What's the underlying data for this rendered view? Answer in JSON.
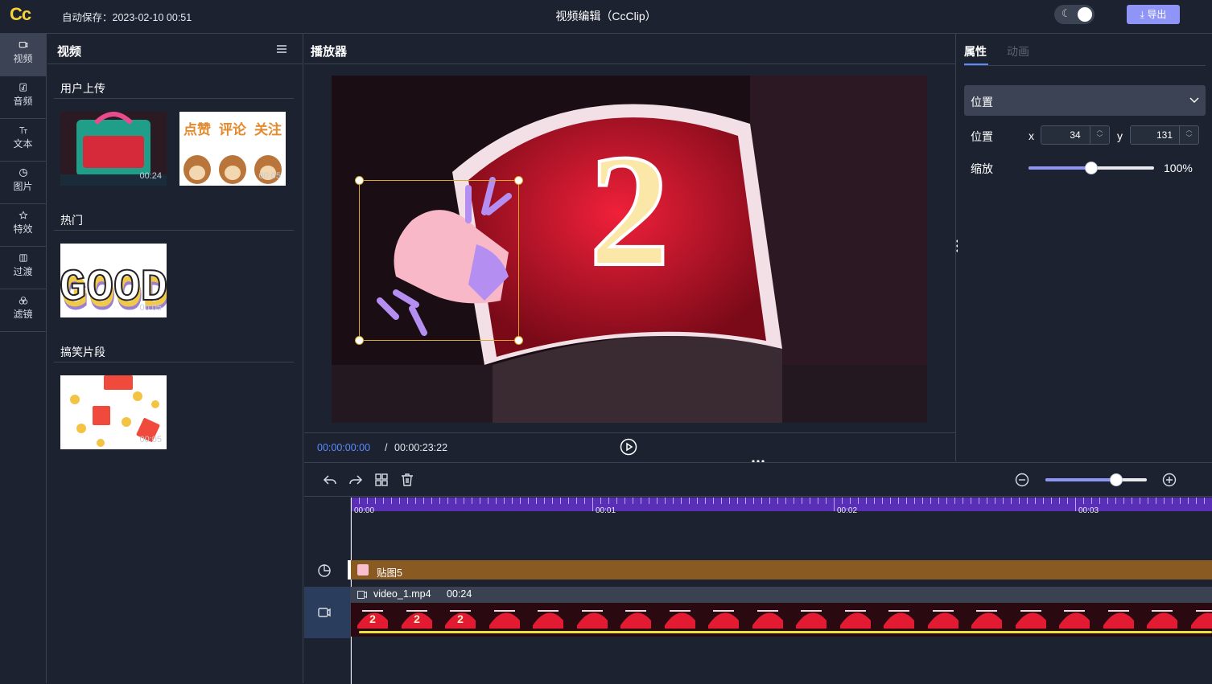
{
  "app": {
    "logo": "Cc",
    "autosave": "自动保存：2023-02-10 00:51",
    "title": "视频编辑（CcClip）",
    "export_label": "导出",
    "theme_icon": "moon-icon"
  },
  "nav": {
    "items": [
      {
        "label": "视频",
        "icon": "video-icon",
        "active": true
      },
      {
        "label": "音频",
        "icon": "music-icon"
      },
      {
        "label": "文本",
        "icon": "text-icon"
      },
      {
        "label": "图片",
        "icon": "image-icon"
      },
      {
        "label": "特效",
        "icon": "effects-icon"
      },
      {
        "label": "过渡",
        "icon": "transition-icon"
      },
      {
        "label": "滤镜",
        "icon": "filter-icon"
      }
    ]
  },
  "media": {
    "title": "视频",
    "sections": [
      {
        "title": "用户上传",
        "items": [
          {
            "duration": "00:24"
          },
          {
            "duration": "00:05",
            "text": [
              "点赞",
              "评论",
              "关注"
            ]
          }
        ]
      },
      {
        "title": "热门",
        "items": [
          {
            "duration": "00:05",
            "text": [
              "GOOD"
            ]
          }
        ]
      },
      {
        "title": "搞笑片段",
        "items": [
          {
            "duration": "00:05"
          }
        ]
      }
    ]
  },
  "player": {
    "title": "播放器",
    "current_time": "00:00:00:00",
    "separator": "/",
    "total_time": "00:00:23:22"
  },
  "props": {
    "tab_active": "属性",
    "tab_inactive": "动画",
    "section_title": "位置",
    "position_label": "位置",
    "x_label": "x",
    "x_value": "34",
    "y_label": "y",
    "y_value": "131",
    "scale_label": "缩放",
    "scale_value": "100%",
    "scale_fraction": 0.5
  },
  "timeline": {
    "zoom_fraction": 0.7,
    "ruler_labels": [
      "00:00",
      "00:01",
      "00:02",
      "00:03"
    ],
    "sticker_clip": "贴图5",
    "video_clip_name": "video_1.mp4",
    "video_clip_duration": "00:24"
  },
  "colors": {
    "accent": "#5b8cff",
    "brand": "#8e95f6",
    "logo": "#f5d33b",
    "sticker_track": "#8a5a23"
  }
}
